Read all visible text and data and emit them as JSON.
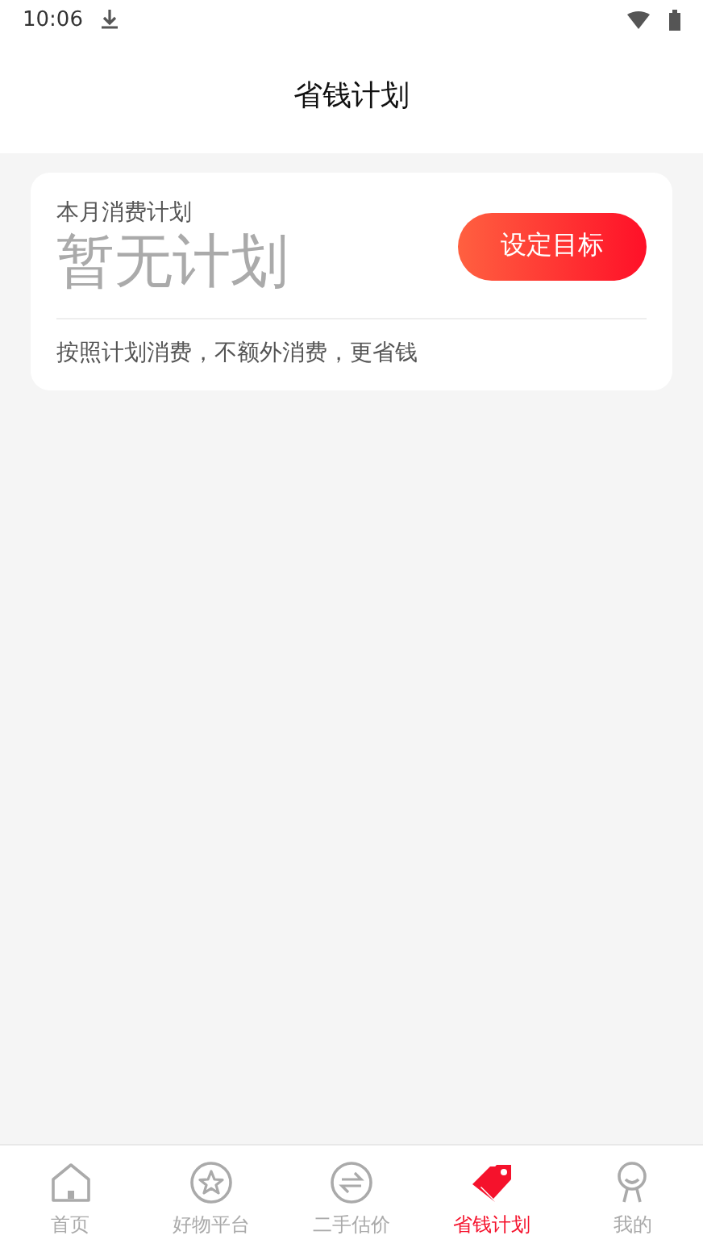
{
  "status_bar": {
    "time": "10:06"
  },
  "header": {
    "title": "省钱计划"
  },
  "plan_card": {
    "label": "本月消费计划",
    "value": "暂无计划",
    "button": "设定目标",
    "note": "按照计划消费，不额外消费，更省钱"
  },
  "tab_bar": [
    {
      "label": "首页",
      "kind": "home",
      "selected": false
    },
    {
      "label": "好物平台",
      "kind": "star",
      "selected": false
    },
    {
      "label": "二手估价",
      "kind": "exchange",
      "selected": false
    },
    {
      "label": "省钱计划",
      "kind": "tag",
      "selected": true
    },
    {
      "label": "我的",
      "kind": "person",
      "selected": false
    }
  ]
}
